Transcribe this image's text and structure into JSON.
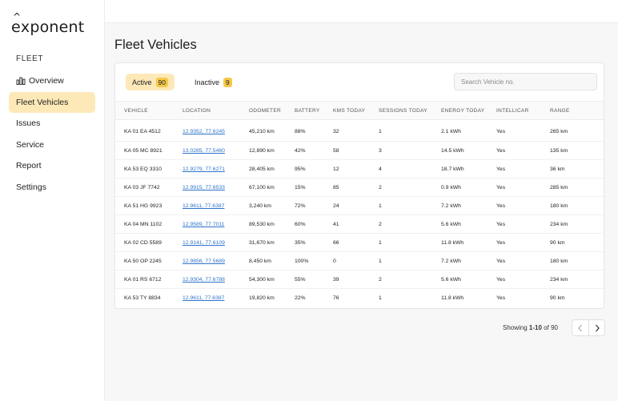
{
  "app": {
    "logo_pre": "e",
    "logo_rest": "xponent"
  },
  "sidebar": {
    "section": "FLEET",
    "items": [
      {
        "label": "Overview",
        "icon": "bar-chart-icon"
      },
      {
        "label": "Fleet Vehicles",
        "active": true
      },
      {
        "label": "Issues"
      },
      {
        "label": "Service"
      },
      {
        "label": "Report"
      },
      {
        "label": "Settings"
      }
    ]
  },
  "main": {
    "title": "Fleet Vehicles"
  },
  "tabs": [
    {
      "label": "Active",
      "count": "90"
    },
    {
      "label": "Inactive",
      "count": "9"
    }
  ],
  "search": {
    "placeholder": "Search Vehicle no.",
    "value": ""
  },
  "table": {
    "headers": [
      "VEHICLE",
      "LOCATION",
      "ODOMETER",
      "BATTERY",
      "KMS TODAY",
      "SESSIONS TODAY",
      "ENERGY TODAY",
      "INTELLICAR",
      "RANGE"
    ],
    "rows": [
      [
        "KA 01 EA 4512",
        "12.9352, 77.6245",
        "45,210 km",
        "88%",
        "32",
        "1",
        "2.1 kWh",
        "Yes",
        "265 km"
      ],
      [
        "KA 05 MC 8921",
        "13.0285, 77.5460",
        "12,890 km",
        "42%",
        "58",
        "3",
        "14.5 kWh",
        "Yes",
        "135 km"
      ],
      [
        "KA 53 EQ 3310",
        "12.9279, 77.6271",
        "28,405 km",
        "95%",
        "12",
        "4",
        "18.7 kWh",
        "Yes",
        "36 km"
      ],
      [
        "KA 03 JF 7742",
        "12.9915, 77.6533",
        "67,100 km",
        "15%",
        "85",
        "2",
        "0.9 kWh",
        "Yes",
        "285 km"
      ],
      [
        "KA 51 HG 9923",
        "12.9611, 77.6387",
        "3,240 km",
        "72%",
        "24",
        "1",
        "7.2 kWh",
        "Yes",
        "180 km"
      ],
      [
        "KA 04 MN 1102",
        "12.9589, 77.7011",
        "89,530 km",
        "60%",
        "41",
        "2",
        "5.6 kWh",
        "Yes",
        "234 km"
      ],
      [
        "KA 02 CD 5589",
        "12.9141, 77.6109",
        "31,670 km",
        "35%",
        "66",
        "1",
        "11.8 kWh",
        "Yes",
        "90 km"
      ],
      [
        "KA 50 OP 2245",
        "12.9856, 77.5689",
        "8,450 km",
        "100%",
        "0",
        "1",
        "7.2 kWh",
        "Yes",
        "180 km"
      ],
      [
        "KA 01 RS 6712",
        "12.9304, 77.6788",
        "54,300 km",
        "55%",
        "39",
        "2",
        "5.6 kWh",
        "Yes",
        "234 km"
      ],
      [
        "KA 53 TY 8834",
        "12.9611, 77.6387",
        "19,820 km",
        "22%",
        "76",
        "1",
        "11.8 kWh",
        "Yes",
        "90 km"
      ]
    ]
  },
  "pagination": {
    "prefix": "Showing",
    "range": "1-10",
    "of": "of",
    "total": "90"
  },
  "colors": {
    "accent": "#fde9b8",
    "badge": "#f6c84a",
    "link": "#2f74c9"
  }
}
